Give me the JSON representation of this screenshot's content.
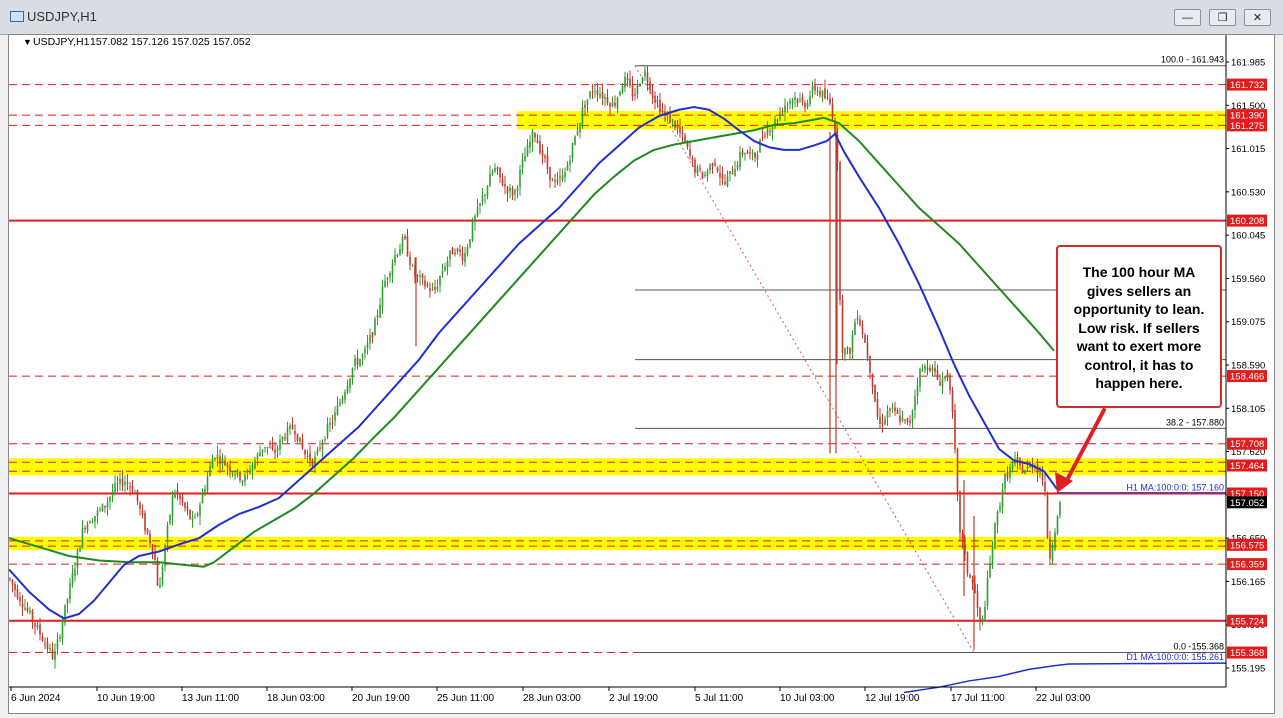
{
  "window": {
    "title": "USDJPY,H1",
    "minimize_label": "—",
    "restore_label": "❐",
    "close_label": "✕"
  },
  "header": {
    "symbol": "USDJPY,H1",
    "quote": "157.082 157.126 157.025 157.052"
  },
  "callout": {
    "text": "The 100 hour MA gives sellers an opportunity to lean. Low risk.  If sellers want to exert more control, it has to happen here."
  },
  "colors": {
    "bull_candle": "#2f9e2f",
    "bear_candle": "#c0392b",
    "ma_100_hour": "#1f2fd0",
    "ma_200_hour": "#1d8a1d",
    "ma_100_day": "#1f2fd0",
    "level_line": "#e21c1c",
    "zone_fill": "#ffff00",
    "price_tag": "#e21c1c",
    "current_price_tag": "#000000"
  },
  "chart_data": {
    "type": "candlestick",
    "symbol": "USDJPY",
    "timeframe": "H1",
    "ylim": [
      155.0,
      162.1
    ],
    "y_ticks": [
      "161.985",
      "161.500",
      "161.015",
      "160.530",
      "160.045",
      "159.560",
      "159.075",
      "158.590",
      "158.105",
      "157.620",
      "157.135",
      "156.650",
      "156.165",
      "155.680",
      "155.195"
    ],
    "x_ticks": [
      "6 Jun 2024",
      "10 Jun 19:00",
      "13 Jun 11:00",
      "18 Jun 03:00",
      "20 Jun 19:00",
      "25 Jun 11:00",
      "28 Jun 03:00",
      "2 Jul 19:00",
      "5 Jul 11:00",
      "10 Jul 03:00",
      "12 Jul 19:00",
      "17 Jul 11:00",
      "22 Jul 03:00"
    ],
    "price_tags": [
      {
        "label": "161.732",
        "value": 161.732
      },
      {
        "label": "161.390",
        "value": 161.39
      },
      {
        "label": "161.275",
        "value": 161.275
      },
      {
        "label": "160.208",
        "value": 160.208
      },
      {
        "label": "158.466",
        "value": 158.466
      },
      {
        "label": "157.708",
        "value": 157.708
      },
      {
        "label": "157.464",
        "value": 157.464
      },
      {
        "label": "157.150",
        "value": 157.15
      },
      {
        "label": "156.575",
        "value": 156.575
      },
      {
        "label": "156.359",
        "value": 156.359
      },
      {
        "label": "155.724",
        "value": 155.724
      },
      {
        "label": "155.368",
        "value": 155.368
      }
    ],
    "current_price": {
      "label": "157.052",
      "value": 157.052
    },
    "solid_levels": [
      160.208,
      157.15,
      155.724
    ],
    "dashed_levels": [
      161.732,
      158.466,
      157.708,
      156.359,
      155.368
    ],
    "zones": [
      {
        "low": 161.275,
        "high": 161.39
      },
      {
        "low": 157.4,
        "high": 157.5
      },
      {
        "low": 156.56,
        "high": 156.62
      }
    ],
    "fibonacci": {
      "levels_labeled": [
        {
          "label": "100.0 - 161.943",
          "value": 161.943
        },
        {
          "label": "38.2 - 157.880",
          "value": 157.88
        },
        {
          "label": "0.0 -155.368",
          "value": 155.368
        }
      ],
      "levels_unlabeled": [
        159.43,
        158.65
      ]
    },
    "indicator_labels": [
      {
        "label": "H1 MA:100:0:0: 157.160",
        "value": 157.16
      },
      {
        "label": "D1 MA:100:0:0: 155.261",
        "value": 155.261
      }
    ],
    "ma_100_hour": [
      [
        0,
        156.3
      ],
      [
        20,
        156.05
      ],
      [
        40,
        155.85
      ],
      [
        55,
        155.75
      ],
      [
        70,
        155.8
      ],
      [
        85,
        155.95
      ],
      [
        100,
        156.15
      ],
      [
        115,
        156.35
      ],
      [
        130,
        156.45
      ],
      [
        150,
        156.5
      ],
      [
        170,
        156.58
      ],
      [
        190,
        156.65
      ],
      [
        210,
        156.8
      ],
      [
        230,
        156.92
      ],
      [
        250,
        157.0
      ],
      [
        270,
        157.1
      ],
      [
        290,
        157.3
      ],
      [
        310,
        157.5
      ],
      [
        330,
        157.7
      ],
      [
        350,
        157.9
      ],
      [
        370,
        158.15
      ],
      [
        390,
        158.4
      ],
      [
        410,
        158.65
      ],
      [
        430,
        158.95
      ],
      [
        450,
        159.2
      ],
      [
        470,
        159.45
      ],
      [
        490,
        159.7
      ],
      [
        510,
        159.95
      ],
      [
        530,
        160.15
      ],
      [
        550,
        160.35
      ],
      [
        570,
        160.6
      ],
      [
        590,
        160.85
      ],
      [
        610,
        161.05
      ],
      [
        630,
        161.25
      ],
      [
        650,
        161.38
      ],
      [
        670,
        161.45
      ],
      [
        685,
        161.48
      ],
      [
        700,
        161.45
      ],
      [
        715,
        161.35
      ],
      [
        730,
        161.22
      ],
      [
        745,
        161.1
      ],
      [
        760,
        161.03
      ],
      [
        775,
        161.0
      ],
      [
        790,
        161.0
      ],
      [
        805,
        161.05
      ],
      [
        818,
        161.1
      ],
      [
        826,
        161.18
      ],
      [
        835,
        160.98
      ],
      [
        850,
        160.7
      ],
      [
        870,
        160.35
      ],
      [
        890,
        159.95
      ],
      [
        910,
        159.5
      ],
      [
        930,
        159.0
      ],
      [
        945,
        158.6
      ],
      [
        960,
        158.25
      ],
      [
        975,
        157.95
      ],
      [
        990,
        157.65
      ],
      [
        1005,
        157.52
      ],
      [
        1020,
        157.48
      ],
      [
        1035,
        157.4
      ],
      [
        1048,
        157.2
      ]
    ],
    "ma_200_hour": [
      [
        0,
        156.65
      ],
      [
        30,
        156.55
      ],
      [
        60,
        156.45
      ],
      [
        90,
        156.4
      ],
      [
        120,
        156.38
      ],
      [
        150,
        156.38
      ],
      [
        175,
        156.35
      ],
      [
        195,
        156.33
      ],
      [
        205,
        156.38
      ],
      [
        225,
        156.55
      ],
      [
        245,
        156.72
      ],
      [
        265,
        156.85
      ],
      [
        285,
        156.98
      ],
      [
        305,
        157.15
      ],
      [
        325,
        157.35
      ],
      [
        345,
        157.55
      ],
      [
        365,
        157.78
      ],
      [
        385,
        158.0
      ],
      [
        405,
        158.25
      ],
      [
        425,
        158.5
      ],
      [
        445,
        158.75
      ],
      [
        465,
        159.0
      ],
      [
        485,
        159.25
      ],
      [
        505,
        159.5
      ],
      [
        525,
        159.75
      ],
      [
        545,
        160.0
      ],
      [
        565,
        160.25
      ],
      [
        585,
        160.5
      ],
      [
        605,
        160.7
      ],
      [
        625,
        160.88
      ],
      [
        645,
        161.0
      ],
      [
        665,
        161.06
      ],
      [
        685,
        161.1
      ],
      [
        705,
        161.14
      ],
      [
        725,
        161.18
      ],
      [
        745,
        161.22
      ],
      [
        765,
        161.28
      ],
      [
        785,
        161.3
      ],
      [
        800,
        161.33
      ],
      [
        815,
        161.36
      ],
      [
        830,
        161.3
      ],
      [
        850,
        161.1
      ],
      [
        870,
        160.85
      ],
      [
        890,
        160.6
      ],
      [
        910,
        160.35
      ],
      [
        930,
        160.15
      ],
      [
        950,
        159.95
      ],
      [
        970,
        159.7
      ],
      [
        990,
        159.45
      ],
      [
        1010,
        159.2
      ],
      [
        1030,
        158.95
      ],
      [
        1045,
        158.75
      ]
    ],
    "ma_100_day": [
      [
        895,
        154.92
      ],
      [
        930,
        154.98
      ],
      [
        960,
        155.05
      ],
      [
        990,
        155.1
      ],
      [
        1020,
        155.18
      ],
      [
        1045,
        155.22
      ],
      [
        1060,
        155.24
      ],
      [
        1217,
        155.25
      ]
    ],
    "price_path": [
      [
        0,
        156.2
      ],
      [
        20,
        155.8
      ],
      [
        35,
        155.5
      ],
      [
        45,
        155.3
      ],
      [
        55,
        155.8
      ],
      [
        65,
        156.3
      ],
      [
        75,
        156.8
      ],
      [
        85,
        156.9
      ],
      [
        95,
        157.0
      ],
      [
        105,
        157.2
      ],
      [
        115,
        157.3
      ],
      [
        125,
        157.2
      ],
      [
        135,
        156.8
      ],
      [
        145,
        156.5
      ],
      [
        150,
        156.0
      ],
      [
        155,
        156.5
      ],
      [
        165,
        157.2
      ],
      [
        175,
        157.0
      ],
      [
        185,
        156.8
      ],
      [
        195,
        157.2
      ],
      [
        205,
        157.6
      ],
      [
        215,
        157.5
      ],
      [
        225,
        157.4
      ],
      [
        235,
        157.3
      ],
      [
        245,
        157.5
      ],
      [
        255,
        157.7
      ],
      [
        265,
        157.6
      ],
      [
        275,
        157.8
      ],
      [
        285,
        157.9
      ],
      [
        295,
        157.6
      ],
      [
        305,
        157.5
      ],
      [
        315,
        157.8
      ],
      [
        325,
        158.0
      ],
      [
        335,
        158.3
      ],
      [
        345,
        158.6
      ],
      [
        355,
        158.7
      ],
      [
        365,
        159.0
      ],
      [
        375,
        159.5
      ],
      [
        385,
        159.8
      ],
      [
        395,
        160.0
      ],
      [
        405,
        159.6
      ],
      [
        415,
        159.5
      ],
      [
        425,
        159.4
      ],
      [
        435,
        159.7
      ],
      [
        445,
        159.9
      ],
      [
        455,
        159.8
      ],
      [
        465,
        160.2
      ],
      [
        475,
        160.5
      ],
      [
        485,
        160.8
      ],
      [
        495,
        160.6
      ],
      [
        505,
        160.5
      ],
      [
        515,
        160.9
      ],
      [
        525,
        161.2
      ],
      [
        535,
        160.9
      ],
      [
        545,
        160.6
      ],
      [
        555,
        160.7
      ],
      [
        565,
        161.1
      ],
      [
        575,
        161.5
      ],
      [
        585,
        161.7
      ],
      [
        595,
        161.6
      ],
      [
        605,
        161.5
      ],
      [
        615,
        161.8
      ],
      [
        625,
        161.6
      ],
      [
        635,
        161.9
      ],
      [
        645,
        161.6
      ],
      [
        655,
        161.4
      ],
      [
        665,
        161.3
      ],
      [
        675,
        161.1
      ],
      [
        685,
        160.8
      ],
      [
        695,
        160.7
      ],
      [
        705,
        160.9
      ],
      [
        715,
        160.6
      ],
      [
        725,
        160.8
      ],
      [
        735,
        161.0
      ],
      [
        745,
        160.9
      ],
      [
        755,
        161.2
      ],
      [
        765,
        161.3
      ],
      [
        775,
        161.5
      ],
      [
        785,
        161.6
      ],
      [
        795,
        161.5
      ],
      [
        805,
        161.7
      ],
      [
        815,
        161.6
      ],
      [
        822,
        161.5
      ],
      [
        828,
        161.1
      ],
      [
        832,
        158.8
      ],
      [
        840,
        158.7
      ],
      [
        848,
        159.2
      ],
      [
        855,
        158.9
      ],
      [
        862,
        158.5
      ],
      [
        870,
        157.9
      ],
      [
        880,
        158.1
      ],
      [
        890,
        158.0
      ],
      [
        900,
        157.9
      ],
      [
        910,
        158.5
      ],
      [
        920,
        158.6
      ],
      [
        930,
        158.4
      ],
      [
        940,
        158.5
      ],
      [
        945,
        157.8
      ],
      [
        950,
        156.8
      ],
      [
        958,
        156.3
      ],
      [
        965,
        156.1
      ],
      [
        972,
        155.6
      ],
      [
        978,
        156.1
      ],
      [
        985,
        156.7
      ],
      [
        995,
        157.3
      ],
      [
        1005,
        157.5
      ],
      [
        1015,
        157.4
      ],
      [
        1025,
        157.5
      ],
      [
        1035,
        157.3
      ],
      [
        1040,
        156.4
      ],
      [
        1045,
        156.7
      ],
      [
        1052,
        157.05
      ]
    ]
  }
}
